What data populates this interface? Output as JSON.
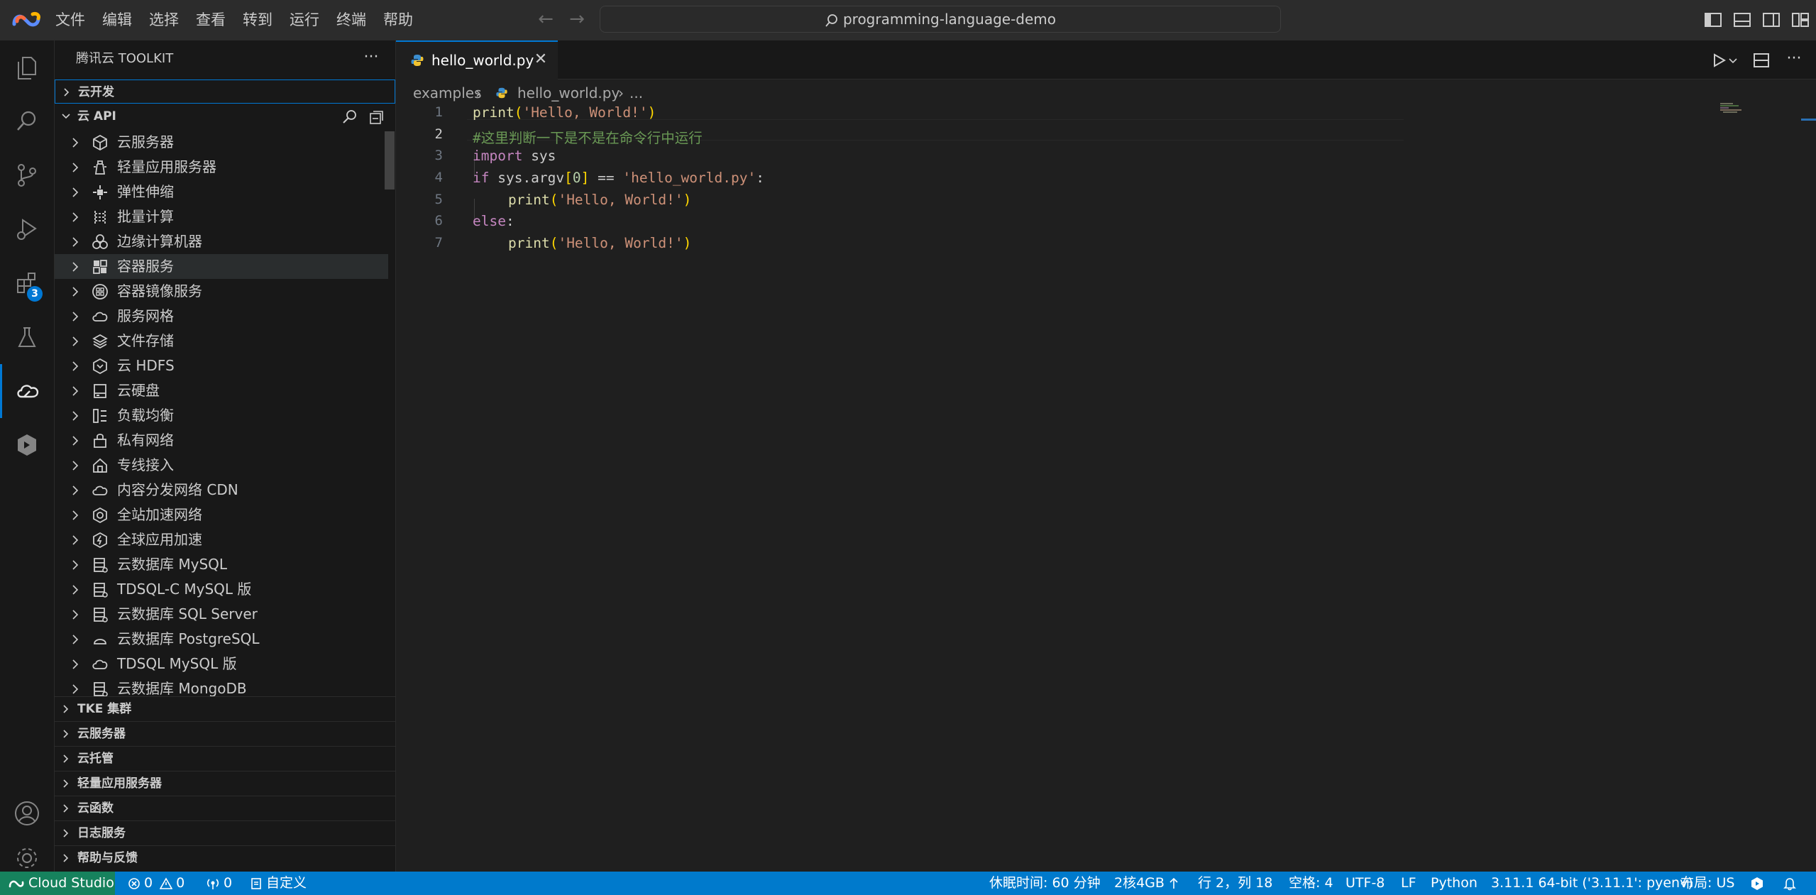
{
  "menubar": {
    "items": [
      "文件",
      "编辑",
      "选择",
      "查看",
      "转到",
      "运行",
      "终端",
      "帮助"
    ]
  },
  "command_center": {
    "text": "programming-language-demo"
  },
  "activity_bar": {
    "extensions_badge": "3"
  },
  "sidebar": {
    "title": "腾讯云 TOOLKIT",
    "sections": {
      "cloud_dev": "云开发",
      "cloud_api": "云 API",
      "tke": "TKE 集群",
      "cvm": "云服务器",
      "hosting": "云托管",
      "lighthouse": "轻量应用服务器",
      "scf": "云函数",
      "cls": "日志服务",
      "help": "帮助与反馈"
    },
    "api_items": [
      {
        "label": "云服务器",
        "icon": "cube-icon"
      },
      {
        "label": "轻量应用服务器",
        "icon": "lighthouse-icon"
      },
      {
        "label": "弹性伸缩",
        "icon": "scaling-icon"
      },
      {
        "label": "批量计算",
        "icon": "batch-icon"
      },
      {
        "label": "边缘计算机器",
        "icon": "edge-icon"
      },
      {
        "label": "容器服务",
        "icon": "container-icon"
      },
      {
        "label": "容器镜像服务",
        "icon": "registry-icon"
      },
      {
        "label": "服务网格",
        "icon": "mesh-cloud-icon"
      },
      {
        "label": "文件存储",
        "icon": "layers-icon"
      },
      {
        "label": "云 HDFS",
        "icon": "hdfs-icon"
      },
      {
        "label": "云硬盘",
        "icon": "disk-icon"
      },
      {
        "label": "负载均衡",
        "icon": "balancer-icon"
      },
      {
        "label": "私有网络",
        "icon": "vpc-icon"
      },
      {
        "label": "专线接入",
        "icon": "direct-connect-icon"
      },
      {
        "label": "内容分发网络 CDN",
        "icon": "cdn-icon"
      },
      {
        "label": "全站加速网络",
        "icon": "ecdn-icon"
      },
      {
        "label": "全球应用加速",
        "icon": "gaap-icon"
      },
      {
        "label": "云数据库 MySQL",
        "icon": "database-icon"
      },
      {
        "label": "TDSQL-C MySQL 版",
        "icon": "database-icon"
      },
      {
        "label": "云数据库 SQL Server",
        "icon": "database-icon"
      },
      {
        "label": "云数据库 PostgreSQL",
        "icon": "postgres-icon"
      },
      {
        "label": "TDSQL MySQL 版",
        "icon": "cloud-db-icon"
      },
      {
        "label": "云数据库 MongoDB",
        "icon": "database-icon"
      }
    ]
  },
  "editor": {
    "tab_label": "hello_world.py",
    "breadcrumb": {
      "folder": "examples",
      "file": "hello_world.py",
      "more": "..."
    },
    "line_numbers": [
      "1",
      "2",
      "3",
      "4",
      "5",
      "6",
      "7"
    ],
    "code": {
      "l1": {
        "fn": "print",
        "open": "(",
        "str": "'Hello, World!'",
        "close": ")"
      },
      "l2": {
        "comment": "#这里判断一下是不是在命令行中运行"
      },
      "l3": {
        "kw": "import",
        "rest": " sys"
      },
      "l4": {
        "kw": "if",
        "a": " sys.argv",
        "b_open": "[",
        "num": "0",
        "b_close": "]",
        "op": " == ",
        "str": "'hello_world.py'",
        "colon": ":"
      },
      "l5": {
        "fn": "print",
        "open": "(",
        "str": "'Hello, World!'",
        "close": ")"
      },
      "l6": {
        "kw": "else",
        "colon": ":"
      },
      "l7": {
        "fn": "print",
        "open": "(",
        "str": "'Hello, World!'",
        "close": ")"
      }
    }
  },
  "statusbar": {
    "remote": "Cloud Studio",
    "errors": "0",
    "warnings": "0",
    "ports": "0",
    "customize": "自定义",
    "sleep": "休眠时间: 60 分钟",
    "machine": "2核4GB",
    "cursor": "行 2，列 18",
    "spaces": "空格: 4",
    "encoding": "UTF-8",
    "eol": "LF",
    "language": "Python",
    "interpreter": "3.11.1 64-bit ('3.11.1': pyenv)",
    "layout": "布局: US"
  }
}
